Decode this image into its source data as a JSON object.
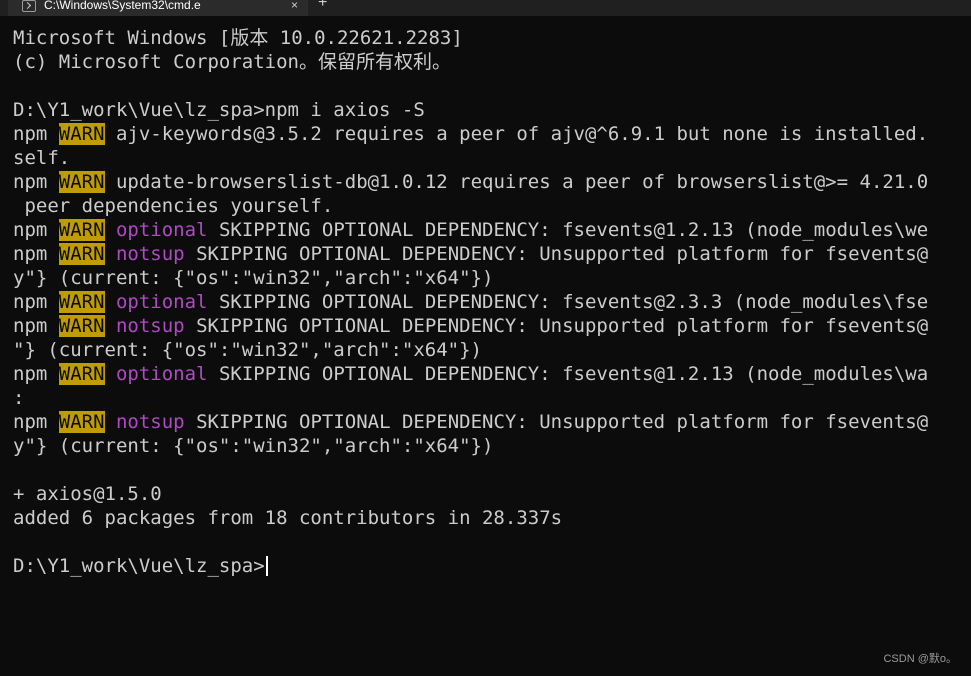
{
  "window": {
    "tab_title": "C:\\Windows\\System32\\cmd.e",
    "tab_close_glyph": "×",
    "new_tab_glyph": "+"
  },
  "terminal": {
    "lines": [
      [
        {
          "t": "Microsoft Windows [版本 10.0.22621.2283]"
        }
      ],
      [
        {
          "t": "(c) Microsoft Corporation。保留所有权利。"
        }
      ],
      [
        {
          "t": ""
        }
      ],
      [
        {
          "t": "D:\\Y1_work\\Vue\\lz_spa>npm i axios -S"
        }
      ],
      [
        {
          "t": "npm "
        },
        {
          "t": "WARN",
          "s": "warn"
        },
        {
          "t": " ajv-keywords@3.5.2 requires a peer of ajv@^6.9.1 but none is installed."
        }
      ],
      [
        {
          "t": "self."
        }
      ],
      [
        {
          "t": "npm "
        },
        {
          "t": "WARN",
          "s": "warn"
        },
        {
          "t": " update-browserslist-db@1.0.12 requires a peer of browserslist@>= 4.21.0"
        }
      ],
      [
        {
          "t": " peer dependencies yourself."
        }
      ],
      [
        {
          "t": "npm "
        },
        {
          "t": "WARN",
          "s": "warn"
        },
        {
          "t": " "
        },
        {
          "t": "optional",
          "s": "magenta"
        },
        {
          "t": " SKIPPING OPTIONAL DEPENDENCY: fsevents@1.2.13 (node_modules\\we"
        }
      ],
      [
        {
          "t": "npm "
        },
        {
          "t": "WARN",
          "s": "warn"
        },
        {
          "t": " "
        },
        {
          "t": "notsup",
          "s": "magenta"
        },
        {
          "t": " SKIPPING OPTIONAL DEPENDENCY: Unsupported platform for fsevents@"
        }
      ],
      [
        {
          "t": "y\"} (current: {\"os\":\"win32\",\"arch\":\"x64\"})"
        }
      ],
      [
        {
          "t": "npm "
        },
        {
          "t": "WARN",
          "s": "warn"
        },
        {
          "t": " "
        },
        {
          "t": "optional",
          "s": "magenta"
        },
        {
          "t": " SKIPPING OPTIONAL DEPENDENCY: fsevents@2.3.3 (node_modules\\fse"
        }
      ],
      [
        {
          "t": "npm "
        },
        {
          "t": "WARN",
          "s": "warn"
        },
        {
          "t": " "
        },
        {
          "t": "notsup",
          "s": "magenta"
        },
        {
          "t": " SKIPPING OPTIONAL DEPENDENCY: Unsupported platform for fsevents@"
        }
      ],
      [
        {
          "t": "\"} (current: {\"os\":\"win32\",\"arch\":\"x64\"})"
        }
      ],
      [
        {
          "t": "npm "
        },
        {
          "t": "WARN",
          "s": "warn"
        },
        {
          "t": " "
        },
        {
          "t": "optional",
          "s": "magenta"
        },
        {
          "t": " SKIPPING OPTIONAL DEPENDENCY: fsevents@1.2.13 (node_modules\\wa"
        }
      ],
      [
        {
          "t": ":"
        }
      ],
      [
        {
          "t": "npm "
        },
        {
          "t": "WARN",
          "s": "warn"
        },
        {
          "t": " "
        },
        {
          "t": "notsup",
          "s": "magenta"
        },
        {
          "t": " SKIPPING OPTIONAL DEPENDENCY: Unsupported platform for fsevents@"
        }
      ],
      [
        {
          "t": "y\"} (current: {\"os\":\"win32\",\"arch\":\"x64\"})"
        }
      ],
      [
        {
          "t": ""
        }
      ],
      [
        {
          "t": "+ axios@1.5.0"
        }
      ],
      [
        {
          "t": "added 6 packages from 18 contributors in 28.337s"
        }
      ],
      [
        {
          "t": ""
        }
      ],
      [
        {
          "t": "D:\\Y1_work\\Vue\\lz_spa>"
        },
        {
          "cursor": true
        }
      ]
    ]
  },
  "watermark": "CSDN @默o。",
  "colors": {
    "background": "#0c0c0c",
    "foreground": "#cccccc",
    "warn_bg": "#c19c00",
    "warn_fg": "#0c0c0c",
    "magenta": "#b148c6"
  }
}
